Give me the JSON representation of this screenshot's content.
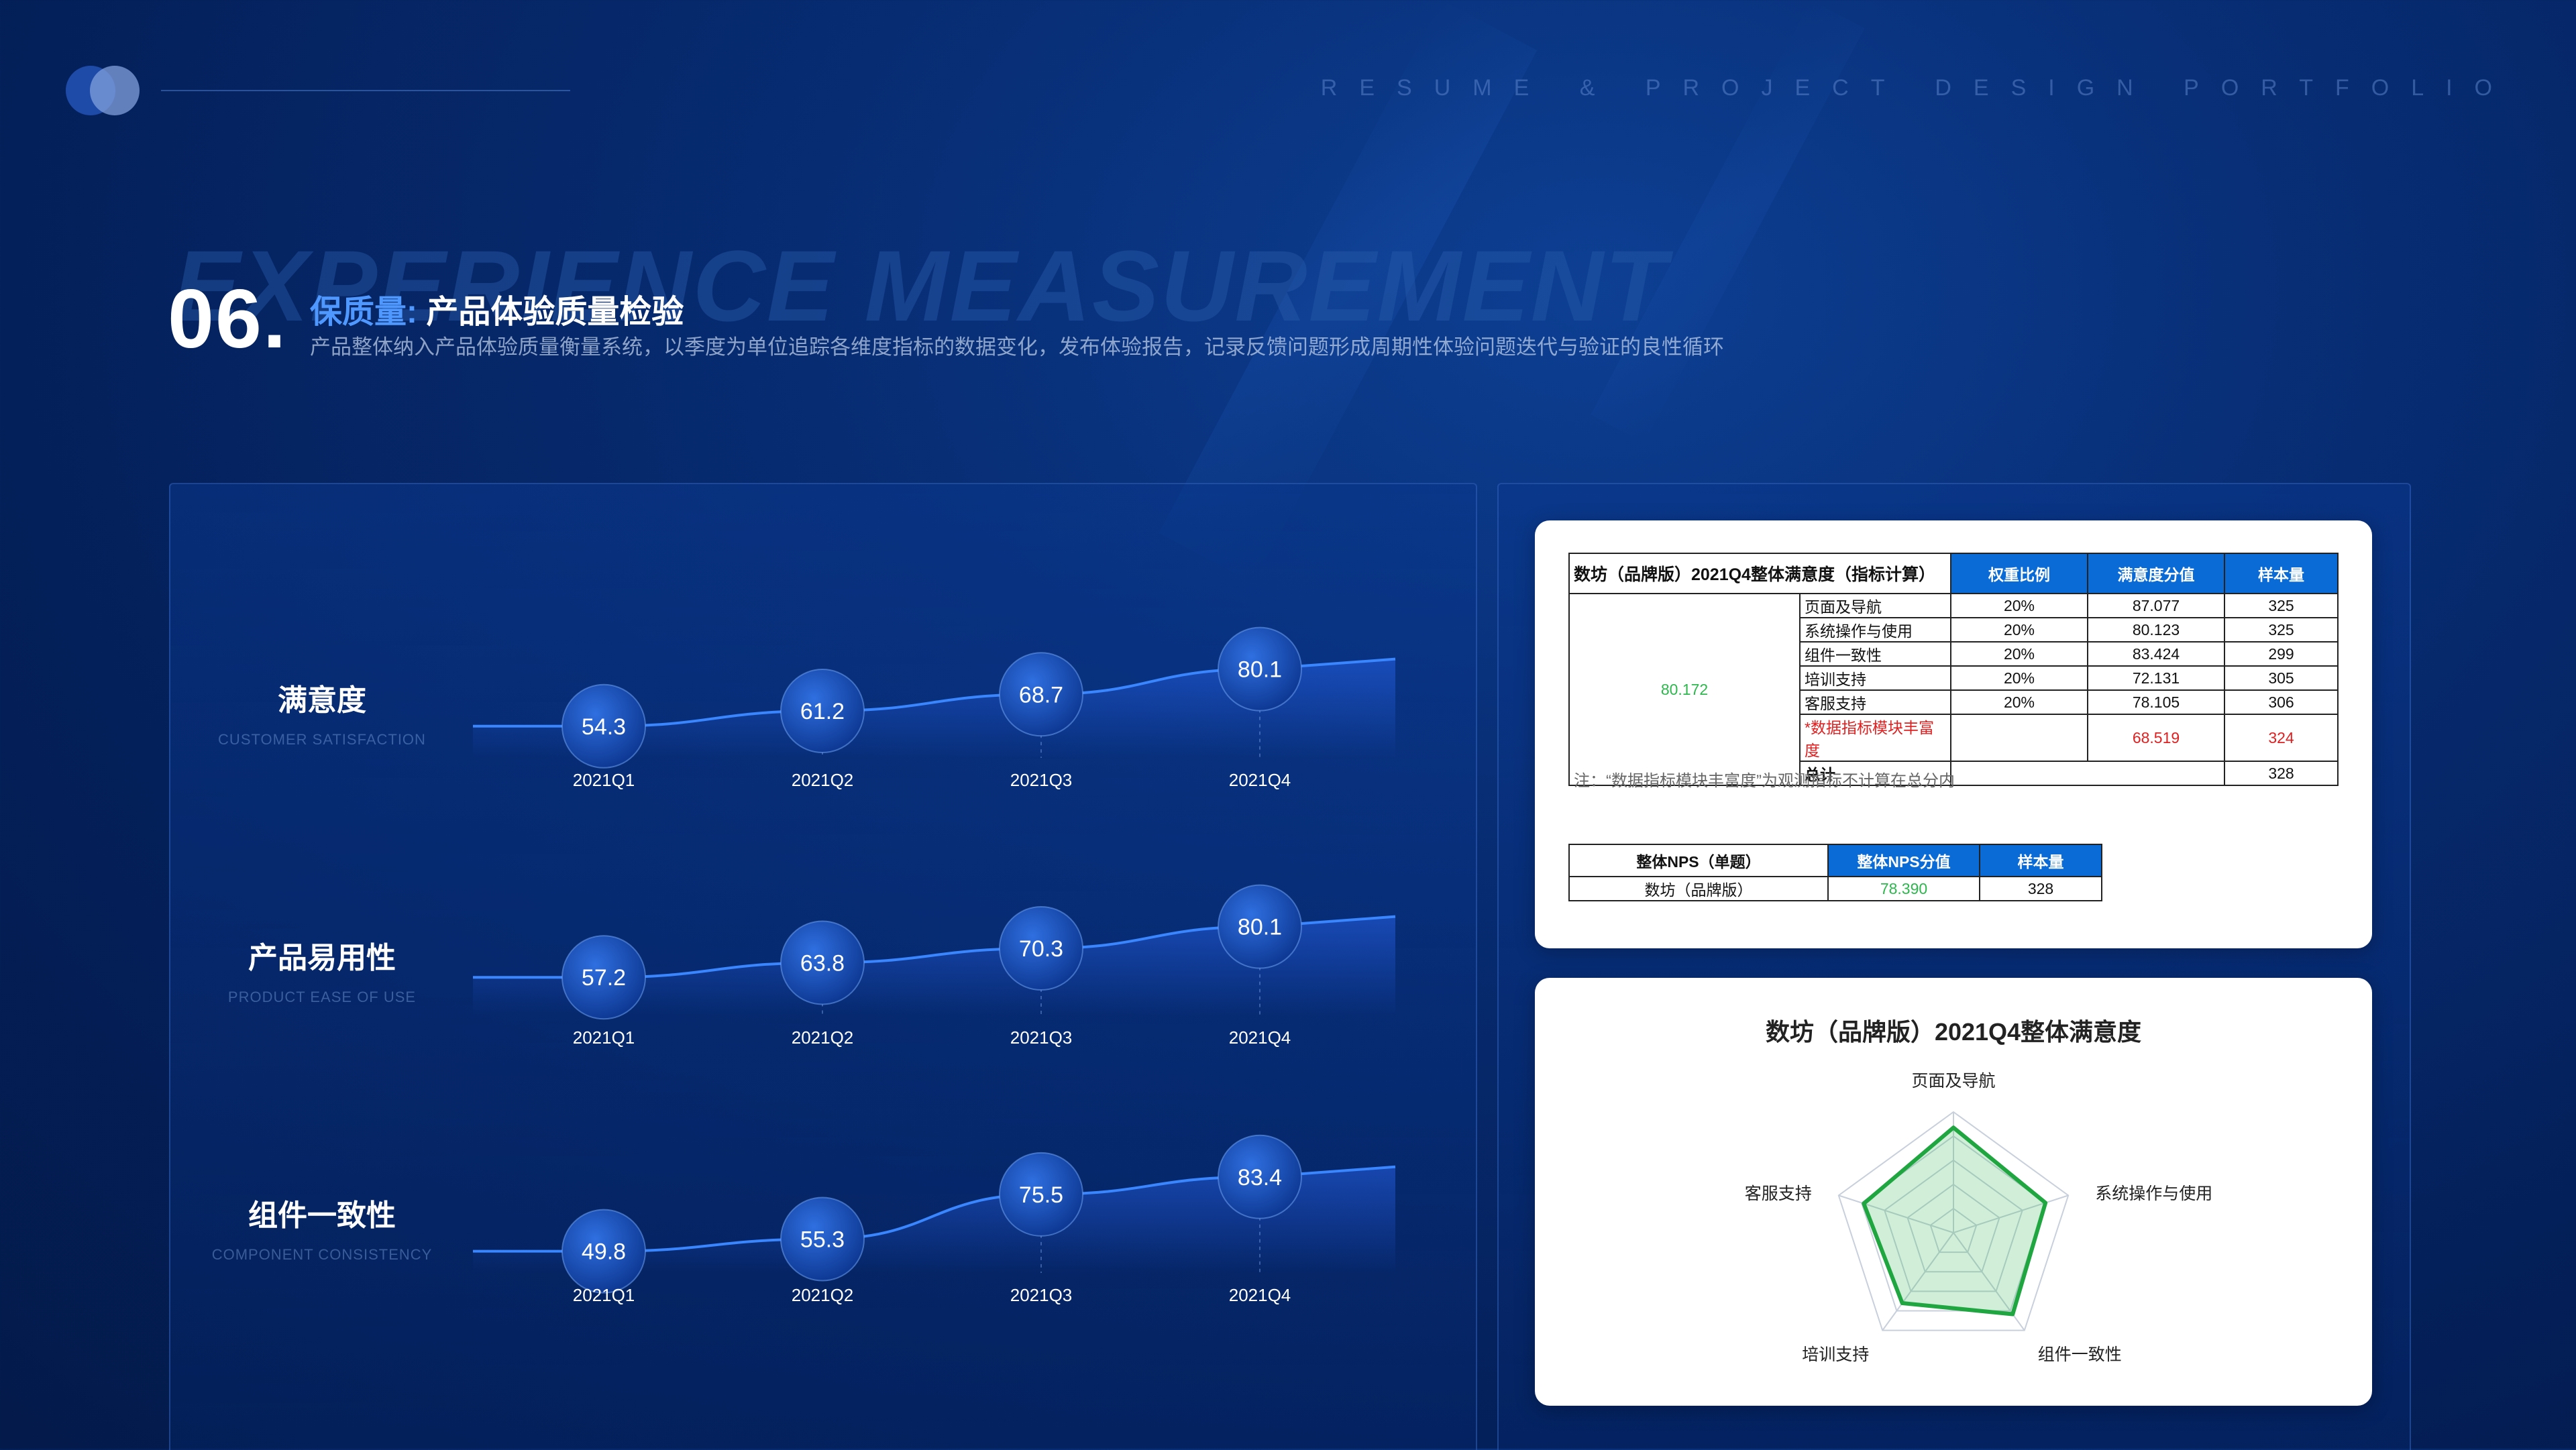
{
  "header": {
    "portfolio_text": "RESUME & PROJECT DESIGN PORTFOLIO",
    "background_title": "EXPERIENCE MEASUREMENT",
    "section_number": "06.",
    "section_title_highlight": "保质量:",
    "section_title": "产品体验质量检验",
    "subtitle": "产品整体纳入产品体验质量衡量系统，以季度为单位追踪各维度指标的数据变化，发布体验报告，记录反馈问题形成周期性体验问题迭代与验证的良性循环"
  },
  "colors": {
    "accent": "#4f98ff",
    "table_header": "#0a6bd6",
    "green": "#2db84d",
    "red": "#e02020"
  },
  "trends": [
    {
      "name_cn": "满意度",
      "name_en": "CUSTOMER SATISFACTION",
      "quarters": [
        "2021Q1",
        "2021Q2",
        "2021Q3",
        "2021Q4"
      ],
      "values": [
        54.3,
        61.2,
        68.7,
        80.1
      ]
    },
    {
      "name_cn": "产品易用性",
      "name_en": "PRODUCT EASE OF USE",
      "quarters": [
        "2021Q1",
        "2021Q2",
        "2021Q3",
        "2021Q4"
      ],
      "values": [
        57.2,
        63.8,
        70.3,
        80.1
      ]
    },
    {
      "name_cn": "组件一致性",
      "name_en": "COMPONENT CONSISTENCY",
      "quarters": [
        "2021Q1",
        "2021Q2",
        "2021Q3",
        "2021Q4"
      ],
      "values": [
        49.8,
        55.3,
        75.5,
        83.4
      ]
    }
  ],
  "table1": {
    "title": "数坊（品牌版）2021Q4整体满意度（指标计算）",
    "headers": [
      "权重比例",
      "满意度分值",
      "样本量"
    ],
    "total_score": "80.172",
    "rows": [
      {
        "name": "页面及导航",
        "weight": "20%",
        "score": "87.077",
        "sample": "325"
      },
      {
        "name": "系统操作与使用",
        "weight": "20%",
        "score": "80.123",
        "sample": "325"
      },
      {
        "name": "组件一致性",
        "weight": "20%",
        "score": "83.424",
        "sample": "299"
      },
      {
        "name": "培训支持",
        "weight": "20%",
        "score": "72.131",
        "sample": "305"
      },
      {
        "name": "客服支持",
        "weight": "20%",
        "score": "78.105",
        "sample": "306"
      }
    ],
    "extra_row": {
      "name": "*数据指标模块丰富度",
      "score": "68.519",
      "sample": "324"
    },
    "total_row": {
      "name": "总计",
      "sample": "328"
    },
    "note": "注：“数据指标模块丰富度”为观测指标不计算在总分内"
  },
  "table2": {
    "headers": [
      "整体NPS（单题）",
      "整体NPS分值",
      "样本量"
    ],
    "row": {
      "name": "数坊（品牌版）",
      "score": "78.390",
      "sample": "328"
    }
  },
  "chart_data": {
    "type": "radar",
    "title": "数坊（品牌版）2021Q4整体满意度",
    "categories": [
      "页面及导航",
      "系统操作与使用",
      "组件一致性",
      "培训支持",
      "客服支持"
    ],
    "values": [
      87.077,
      80.123,
      83.424,
      72.131,
      78.105
    ],
    "ylim": [
      0,
      100
    ]
  }
}
